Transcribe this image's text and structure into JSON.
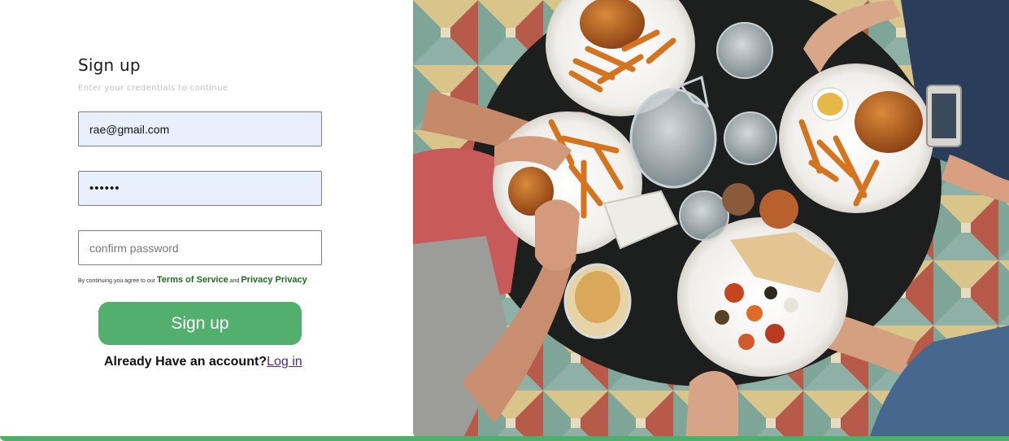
{
  "form": {
    "title": "Sign up",
    "subtitle": "Enter your credentials to continue",
    "email_value": "rae@gmail.com",
    "password_value": "••••••",
    "confirm_placeholder": "confirm password",
    "terms_prefix": "By continuing you agree to our",
    "terms_link": "Terms of Service",
    "terms_and": "and",
    "privacy_link": "Privacy Privacy",
    "submit_label": "Sign up",
    "account_prompt": "Already Have an account?",
    "login_link": "Log in"
  },
  "colors": {
    "accent": "#52af6e",
    "link_green": "#1a6e1a",
    "autofill_bg": "#e8f0fe",
    "login_link": "#4b2a8a"
  }
}
